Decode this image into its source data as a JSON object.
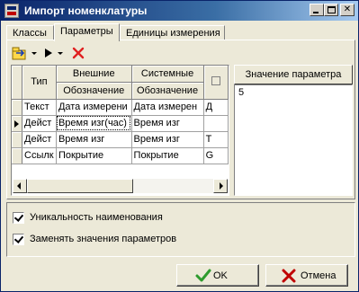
{
  "window": {
    "title": "Импорт номенклатуры"
  },
  "tabs": [
    {
      "label": "Классы",
      "active": false
    },
    {
      "label": "Параметры",
      "active": true
    },
    {
      "label": "Единицы измерения",
      "active": false
    }
  ],
  "toolbar": {
    "icons": [
      "add-dropdown-icon",
      "play-dropdown-icon",
      "delete-icon"
    ]
  },
  "grid": {
    "header_groups": [
      "Тип",
      "Внешние",
      "Системные"
    ],
    "sub_headers": [
      "Обозначение",
      "Обозначение"
    ],
    "rows": [
      {
        "type": "Текст",
        "external": "Дата измерени",
        "system": "Дата измерен",
        "extra": "Д",
        "current": false
      },
      {
        "type": "Дейст",
        "external": "Время изг(час)",
        "system": "Время изг",
        "extra": "",
        "current": true
      },
      {
        "type": "Дейст",
        "external": "Время изг",
        "system": "Время изг",
        "extra": "Т",
        "current": false
      },
      {
        "type": "Ссылк",
        "external": "Покрытие",
        "system": "Покрытие",
        "extra": "G",
        "current": false
      }
    ]
  },
  "param_panel": {
    "header": "Значение параметра",
    "value": "5"
  },
  "options": {
    "unique_names": {
      "label": "Уникальность наименования",
      "checked": true
    },
    "replace_values": {
      "label": "Заменять значения параметров",
      "checked": true
    }
  },
  "buttons": {
    "ok": "OK",
    "cancel": "Отмена"
  },
  "colors": {
    "titlebar": "#0a246a",
    "ok_icon": "#2e9b2e",
    "cancel_icon": "#c00000"
  }
}
